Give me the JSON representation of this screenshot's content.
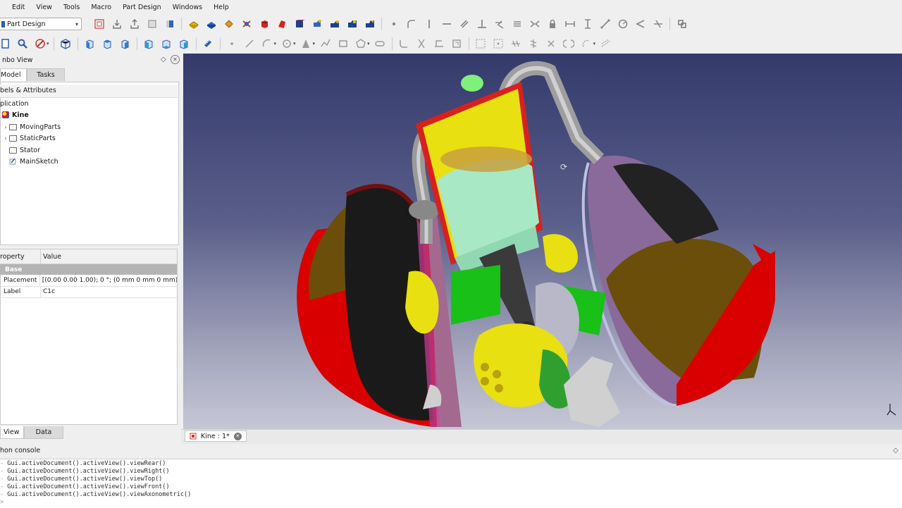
{
  "menu": [
    "Edit",
    "View",
    "Tools",
    "Macro",
    "Part Design",
    "Windows",
    "Help"
  ],
  "toolbar": {
    "workbench_selected": "Part Design",
    "icons_row1": [
      "new-body-icon",
      "sketch-icon",
      "attach-sketch-icon",
      "validate-sketch-icon",
      "clone-icon",
      "pad-icon",
      "pocket-icon",
      "revolution-icon",
      "groove-icon",
      "additive-loft-icon",
      "subtractive-loft-icon",
      "additive-pipe-icon",
      "subtractive-pipe-icon",
      "additive-helix-icon",
      "subtractive-helix-icon"
    ],
    "icons_row2": [
      "fit-all-icon",
      "zoom-icon",
      "draw-style-icon",
      "isometric-icon",
      "front-view-icon",
      "top-view-icon",
      "right-view-icon",
      "rear-view-icon",
      "bottom-view-icon",
      "left-view-icon",
      "measure-icon"
    ]
  },
  "combo": {
    "title": "nbo View",
    "tabs": [
      "Model",
      "Tasks"
    ],
    "section": "bels & Attributes",
    "application": "plication",
    "tree": [
      {
        "label": "Kine",
        "bold": true,
        "indent": 0,
        "expander": false
      },
      {
        "label": "MovingParts",
        "bold": false,
        "indent": 1,
        "expander": true
      },
      {
        "label": "StaticParts",
        "bold": false,
        "indent": 1,
        "expander": true
      },
      {
        "label": "Stator",
        "bold": false,
        "indent": 1,
        "expander": false
      },
      {
        "label": "MainSketch",
        "bold": false,
        "indent": 1,
        "expander": false
      }
    ],
    "property_col": "roperty",
    "value_col": "Value",
    "group": "Base",
    "rows": [
      {
        "name": "Placement",
        "value": "[(0.00 0.00 1.00); 0 °; (0 mm  0 mm  0 mm)]"
      },
      {
        "name": "Label",
        "value": "C1c"
      }
    ],
    "bottom_tabs": [
      "View",
      "Data"
    ]
  },
  "document": {
    "tab_label": "Kine : 1*"
  },
  "console": {
    "title": "hon console",
    "lines": [
      "Gui.activeDocument().activeView().viewRear()",
      "Gui.activeDocument().activeView().viewRight()",
      "Gui.activeDocument().activeView().viewTop()",
      "Gui.activeDocument().activeView().viewFront()",
      "Gui.activeDocument().activeView().viewAxonometric()"
    ]
  },
  "colors": {
    "viewport_top": "#343a6b",
    "viewport_bottom": "#c6c7d5",
    "shell_red": "#d80000",
    "shell_brown": "#6b4e0a",
    "cylinder_green": "#a8e8c4",
    "yellow": "#e8e010",
    "green_part": "#18c018",
    "pipe_grey": "#a8a8a8"
  }
}
